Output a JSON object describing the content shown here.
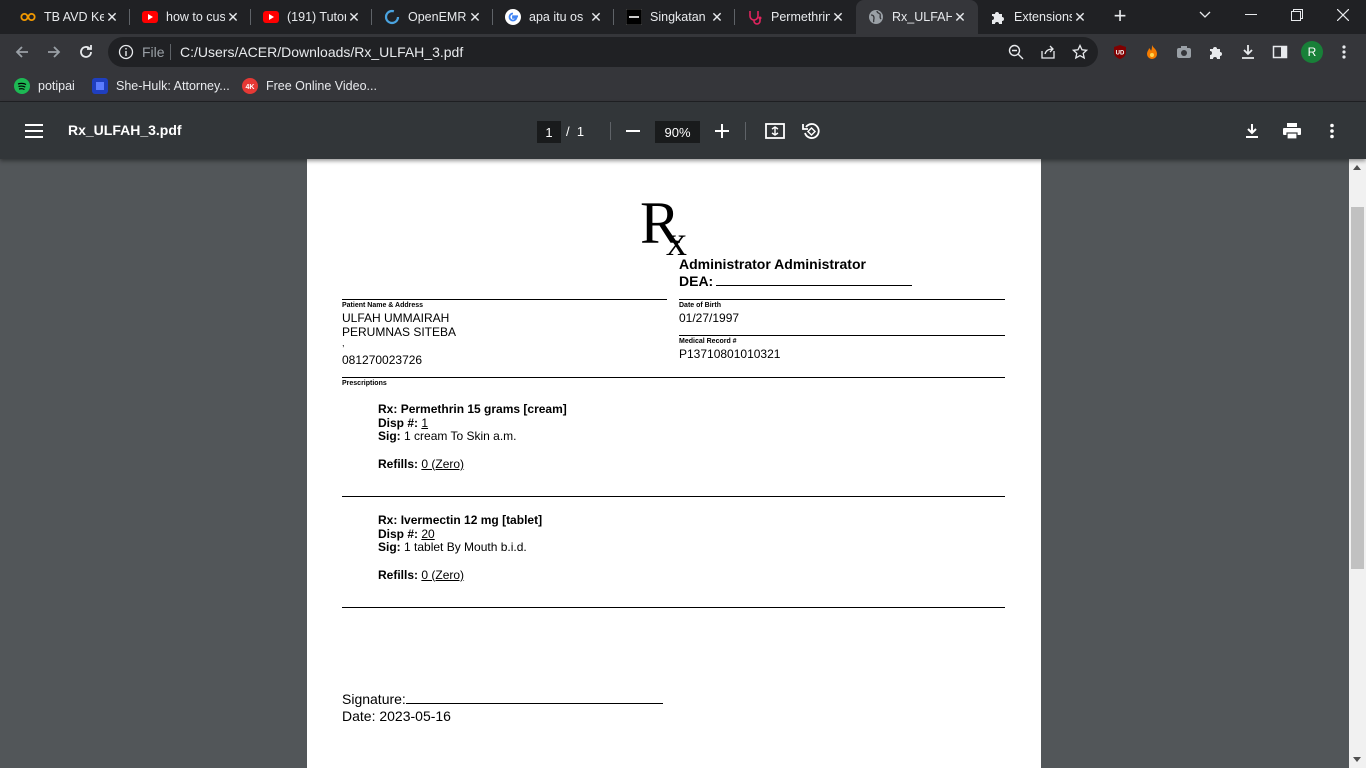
{
  "browser": {
    "tabs": [
      {
        "title": "TB AVD Ke",
        "icon": "infinity-icon",
        "active": false
      },
      {
        "title": "how to cus",
        "icon": "youtube-icon",
        "active": false
      },
      {
        "title": "(191) Tutor",
        "icon": "youtube-icon",
        "active": false
      },
      {
        "title": "OpenEMR",
        "icon": "openemr-icon",
        "active": false
      },
      {
        "title": "apa itu os",
        "icon": "google-icon",
        "active": false
      },
      {
        "title": "Singkatan",
        "icon": "site-icon",
        "active": false
      },
      {
        "title": "Permethrin",
        "icon": "stethoscope-icon",
        "active": false
      },
      {
        "title": "Rx_ULFAH_",
        "icon": "globe-icon",
        "active": true
      },
      {
        "title": "Extensions",
        "icon": "puzzle-icon",
        "active": false
      }
    ],
    "address": {
      "scheme": "File",
      "url": "C:/Users/ACER/Downloads/Rx_ULFAH_3.pdf"
    },
    "profile_initial": "R",
    "accent": "#188038",
    "bookmarks": [
      {
        "label": "potipai",
        "icon": "spotify-icon"
      },
      {
        "label": "She-Hulk: Attorney...",
        "icon": "bookmark-site-icon"
      },
      {
        "label": "Free Online Video...",
        "icon": "4k-icon",
        "icon_text": "4K"
      }
    ]
  },
  "pdf_viewer": {
    "file_name": "Rx_ULFAH_3.pdf",
    "current_page": "1",
    "page_separator": "/",
    "total_pages": "1",
    "zoom": "90%"
  },
  "document": {
    "prescriber_name": "Administrator Administrator",
    "dea_label": "DEA:",
    "patient_label": "Patient Name & Address",
    "patient_name": "ULFAH UMMAIRAH",
    "patient_address": "PERUMNAS SITEBA",
    "patient_address2": ",",
    "patient_phone": "081270023726",
    "dob_label": "Date of Birth",
    "dob": "01/27/1997",
    "mrn_label": "Medical Record #",
    "mrn": "P13710801010321",
    "prescriptions_label": "Prescriptions",
    "prescriptions": [
      {
        "rx_label": "Rx:",
        "drug": "Permethrin 15 grams [cream]",
        "disp_label": "Disp #:",
        "disp": "1",
        "sig_label": "Sig:",
        "sig": "1 cream To Skin a.m.",
        "refills_label": "Refills:",
        "refills": "0 (Zero)"
      },
      {
        "rx_label": "Rx:",
        "drug": "Ivermectin 12 mg [tablet]",
        "disp_label": "Disp #:",
        "disp": "20",
        "sig_label": "Sig:",
        "sig": "1 tablet By Mouth b.i.d.",
        "refills_label": "Refills:",
        "refills": "0 (Zero)"
      }
    ],
    "signature_label": "Signature:",
    "date_label": "Date:",
    "date": "2023-05-16"
  }
}
